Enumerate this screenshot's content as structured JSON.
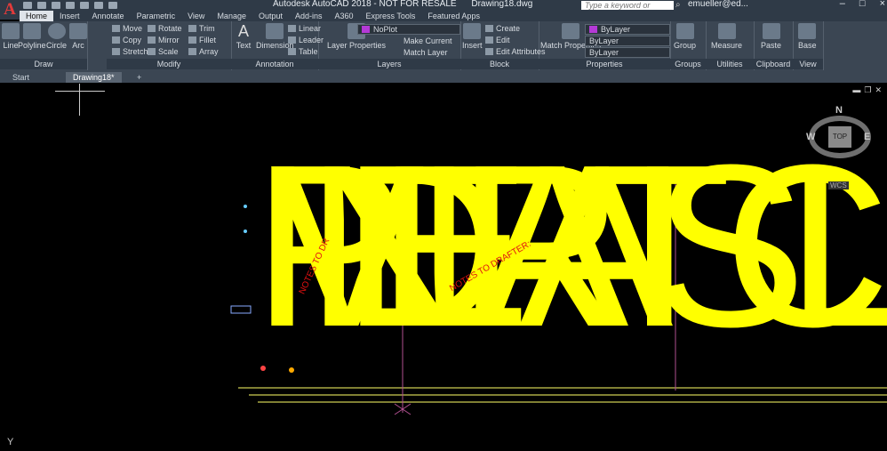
{
  "app": {
    "logo": "A",
    "title": "Autodesk AutoCAD 2018 - NOT FOR RESALE",
    "filename": "Drawing18.dwg",
    "search_placeholder": "Type a keyword or phrase",
    "user": "emueller@ed..."
  },
  "window_controls": [
    "–",
    "□",
    "×"
  ],
  "tabs": [
    "Home",
    "Insert",
    "Annotate",
    "Parametric",
    "View",
    "Manage",
    "Output",
    "Add-ins",
    "A360",
    "Express Tools",
    "Featured Apps"
  ],
  "ribbon": {
    "draw": {
      "label": "Draw",
      "line": "Line",
      "polyline": "Polyline",
      "circle": "Circle",
      "arc": "Arc"
    },
    "modify": {
      "label": "Modify",
      "move": "Move",
      "rotate": "Rotate",
      "trim": "Trim",
      "copy": "Copy",
      "mirror": "Mirror",
      "fillet": "Fillet",
      "stretch": "Stretch",
      "scale": "Scale",
      "array": "Array"
    },
    "annotation": {
      "label": "Annotation",
      "text": "Text",
      "dimension": "Dimension",
      "linear": "Linear",
      "leader": "Leader",
      "table": "Table"
    },
    "layers": {
      "label": "Layers",
      "layer_properties": "Layer Properties",
      "current_layer": "NoPlot",
      "make_current": "Make Current",
      "match_layer": "Match Layer"
    },
    "block": {
      "label": "Block",
      "insert": "Insert",
      "create": "Create",
      "edit": "Edit",
      "edit_attributes": "Edit Attributes"
    },
    "properties": {
      "label": "Properties",
      "match_properties": "Match Properties",
      "color": "ByLayer",
      "linetype": "ByLayer",
      "lineweight": "ByLayer"
    },
    "groups": {
      "label": "Groups",
      "group": "Group"
    },
    "utilities": {
      "label": "Utilities",
      "measure": "Measure"
    },
    "clipboard": {
      "label": "Clipboard",
      "paste": "Paste"
    },
    "view": {
      "label": "View",
      "base": "Base"
    }
  },
  "doc_tabs": {
    "start": "Start",
    "drawing": "Drawing18*",
    "new": "+"
  },
  "canvas": {
    "big_letters": [
      "P",
      "N",
      "E",
      "R",
      "A",
      "T",
      "S",
      "C",
      "V",
      "D",
      "A",
      "I",
      "L"
    ],
    "note_1": "NOTES TO DRAFTER:",
    "note_2": "NOTES TO DR",
    "viewcube": {
      "n": "N",
      "e": "E",
      "w": "W",
      "top": "TOP",
      "wcs": "WCS"
    },
    "ucs_y": "Y"
  },
  "colors": {
    "accent_yellow": "#ffff00",
    "note_red": "#e01010",
    "ribbon": "#3b4653"
  }
}
